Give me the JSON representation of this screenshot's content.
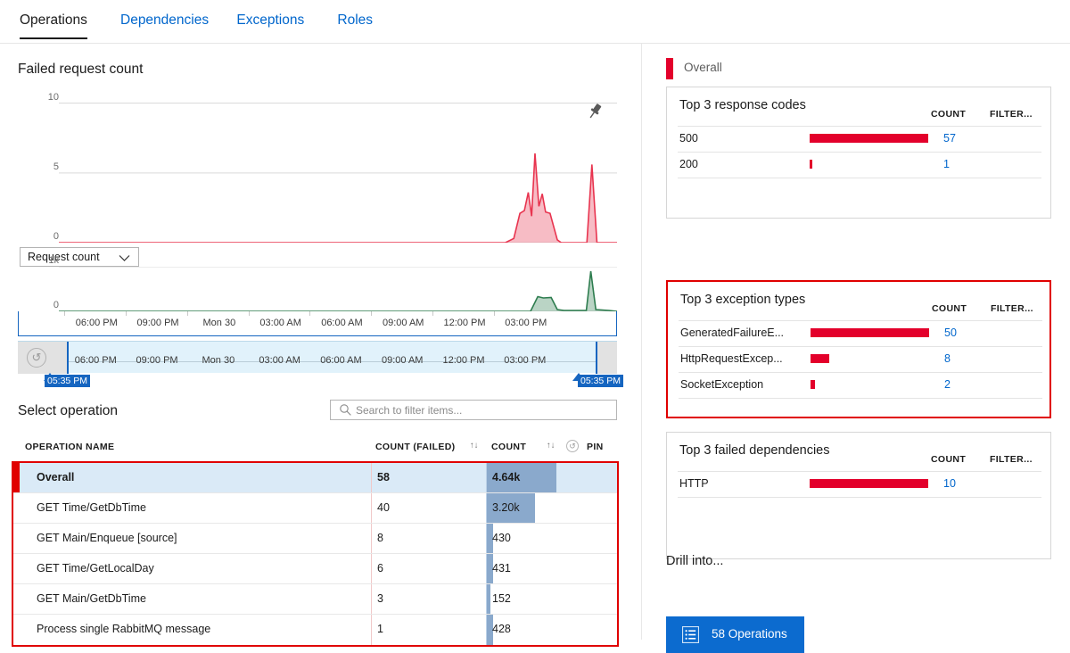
{
  "tabs": [
    {
      "label": "Operations",
      "active": true
    },
    {
      "label": "Dependencies",
      "active": false
    },
    {
      "label": "Exceptions",
      "active": false
    },
    {
      "label": "Roles",
      "active": false
    }
  ],
  "left": {
    "chart_title": "Failed request count",
    "pin_icon": "pin-icon",
    "metric_select": {
      "value": "Request count",
      "chevron": "chevron-down-icon"
    },
    "reset_zoom_icon": "undo-icon",
    "select_operation_title": "Select operation",
    "search": {
      "placeholder": "Search to filter items...",
      "value": "",
      "icon": "search-icon"
    },
    "table": {
      "headers": {
        "name": "OPERATION NAME",
        "count_failed": "COUNT (FAILED)",
        "count": "COUNT",
        "pin": "PIN",
        "sort_icon": "↑↓",
        "pin_icon": "pin-circle-icon"
      },
      "rows": [
        {
          "name": "Overall",
          "count_failed": "58",
          "count": "4.64k",
          "count_value": 4640,
          "selected": true
        },
        {
          "name": "GET Time/GetDbTime",
          "count_failed": "40",
          "count": "3.20k",
          "count_value": 3200,
          "selected": false
        },
        {
          "name": "GET Main/Enqueue [source]",
          "count_failed": "8",
          "count": "430",
          "count_value": 430,
          "selected": false
        },
        {
          "name": "GET Time/GetLocalDay",
          "count_failed": "6",
          "count": "431",
          "count_value": 431,
          "selected": false
        },
        {
          "name": "GET Main/GetDbTime",
          "count_failed": "3",
          "count": "152",
          "count_value": 152,
          "selected": false
        },
        {
          "name": "Process single RabbitMQ message",
          "count_failed": "1",
          "count": "428",
          "count_value": 428,
          "selected": false
        }
      ]
    },
    "time_axis_ticks": [
      "06:00 PM",
      "09:00 PM",
      "Mon 30",
      "03:00 AM",
      "06:00 AM",
      "09:00 AM",
      "12:00 PM",
      "03:00 PM"
    ],
    "slider": {
      "left_label": "05:35 PM",
      "right_label": "05:35 PM"
    }
  },
  "right": {
    "overall_label": "Overall",
    "cards": [
      {
        "title": "Top 3 response codes",
        "count_header": "COUNT",
        "filter_header": "FILTER...",
        "highlight": false,
        "rows": [
          {
            "name": "500",
            "count": "57",
            "value": 57
          },
          {
            "name": "200",
            "count": "1",
            "value": 1
          }
        ]
      },
      {
        "title": "Top 3 exception types",
        "count_header": "COUNT",
        "filter_header": "FILTER...",
        "highlight": true,
        "rows": [
          {
            "name": "GeneratedFailureE...",
            "count": "50",
            "value": 50
          },
          {
            "name": "HttpRequestExcep...",
            "count": "8",
            "value": 8
          },
          {
            "name": "SocketException",
            "count": "2",
            "value": 2
          }
        ]
      },
      {
        "title": "Top 3 failed dependencies",
        "count_header": "COUNT",
        "filter_header": "FILTER...",
        "highlight": false,
        "rows": [
          {
            "name": "HTTP",
            "count": "10",
            "value": 10
          }
        ]
      }
    ],
    "drill_label": "Drill into...",
    "drill_button": {
      "label": "58 Operations",
      "icon": "list-icon"
    }
  },
  "colors": {
    "accent_red": "#e3002b",
    "link_blue": "#0066cc",
    "button_blue": "#0c6bcf",
    "selected_row": "#daeaf7",
    "bar_blue": "#8aa9cc",
    "failed_line": "#e8344f",
    "request_line": "#2e7d4f"
  },
  "chart_data": [
    {
      "type": "area",
      "title": "Failed request count",
      "ylabel": "",
      "xlabel": "",
      "ylim": [
        0,
        11
      ],
      "yticks": [
        0,
        5,
        10
      ],
      "ytick_labels": [
        "0",
        "5",
        "10"
      ],
      "grid": true,
      "series": [
        {
          "name": "Failed request count",
          "color": "#e8344f",
          "x_ticks": [
            "06:00 PM",
            "09:00 PM",
            "Mon 30",
            "03:00 AM",
            "06:00 AM",
            "09:00 AM",
            "12:00 PM",
            "03:00 PM"
          ],
          "points": [
            {
              "x": 0.0,
              "y": 0
            },
            {
              "x": 0.8,
              "y": 0
            },
            {
              "x": 0.815,
              "y": 0.3
            },
            {
              "x": 0.826,
              "y": 2.1
            },
            {
              "x": 0.834,
              "y": 2.3
            },
            {
              "x": 0.841,
              "y": 3.6
            },
            {
              "x": 0.847,
              "y": 1.9
            },
            {
              "x": 0.853,
              "y": 6.4
            },
            {
              "x": 0.86,
              "y": 2.6
            },
            {
              "x": 0.866,
              "y": 3.5
            },
            {
              "x": 0.872,
              "y": 2.2
            },
            {
              "x": 0.88,
              "y": 2.1
            },
            {
              "x": 0.893,
              "y": 0.2
            },
            {
              "x": 0.9,
              "y": 0
            },
            {
              "x": 0.946,
              "y": 0
            },
            {
              "x": 0.955,
              "y": 5.6
            },
            {
              "x": 0.964,
              "y": 0
            },
            {
              "x": 1.0,
              "y": 0
            }
          ]
        }
      ]
    },
    {
      "type": "area",
      "title": "Request count",
      "ylabel": "",
      "xlabel": "",
      "ylim": [
        0,
        1000
      ],
      "yticks": [
        0,
        1000
      ],
      "ytick_labels": [
        "0",
        "1k"
      ],
      "grid": true,
      "series": [
        {
          "name": "Request count",
          "color": "#2e7d4f",
          "x_ticks": [
            "06:00 PM",
            "09:00 PM",
            "Mon 30",
            "03:00 AM",
            "06:00 AM",
            "09:00 AM",
            "12:00 PM",
            "03:00 PM"
          ],
          "points": [
            {
              "x": 0.0,
              "y": 0
            },
            {
              "x": 0.845,
              "y": 0
            },
            {
              "x": 0.858,
              "y": 330
            },
            {
              "x": 0.868,
              "y": 300
            },
            {
              "x": 0.882,
              "y": 310
            },
            {
              "x": 0.893,
              "y": 40
            },
            {
              "x": 0.905,
              "y": 20
            },
            {
              "x": 0.945,
              "y": 20
            },
            {
              "x": 0.953,
              "y": 900
            },
            {
              "x": 0.962,
              "y": 40
            },
            {
              "x": 0.985,
              "y": 20
            },
            {
              "x": 1.0,
              "y": 0
            }
          ]
        }
      ]
    },
    {
      "type": "bar",
      "title": "Top 3 response codes",
      "categories": [
        "500",
        "200"
      ],
      "values": [
        57,
        1
      ],
      "xlabel": "",
      "ylabel": "COUNT",
      "ylim": [
        0,
        57
      ]
    },
    {
      "type": "bar",
      "title": "Top 3 exception types",
      "categories": [
        "GeneratedFailureE...",
        "HttpRequestExcep...",
        "SocketException"
      ],
      "values": [
        50,
        8,
        2
      ],
      "xlabel": "",
      "ylabel": "COUNT",
      "ylim": [
        0,
        50
      ]
    },
    {
      "type": "bar",
      "title": "Top 3 failed dependencies",
      "categories": [
        "HTTP"
      ],
      "values": [
        10
      ],
      "xlabel": "",
      "ylabel": "COUNT",
      "ylim": [
        0,
        10
      ]
    },
    {
      "type": "table",
      "title": "Select operation",
      "columns": [
        "OPERATION NAME",
        "COUNT (FAILED)",
        "COUNT"
      ],
      "rows": [
        [
          "Overall",
          58,
          4640
        ],
        [
          "GET Time/GetDbTime",
          40,
          3200
        ],
        [
          "GET Main/Enqueue [source]",
          8,
          430
        ],
        [
          "GET Time/GetLocalDay",
          6,
          431
        ],
        [
          "GET Main/GetDbTime",
          3,
          152
        ],
        [
          "Process single RabbitMQ message",
          1,
          428
        ]
      ]
    }
  ]
}
